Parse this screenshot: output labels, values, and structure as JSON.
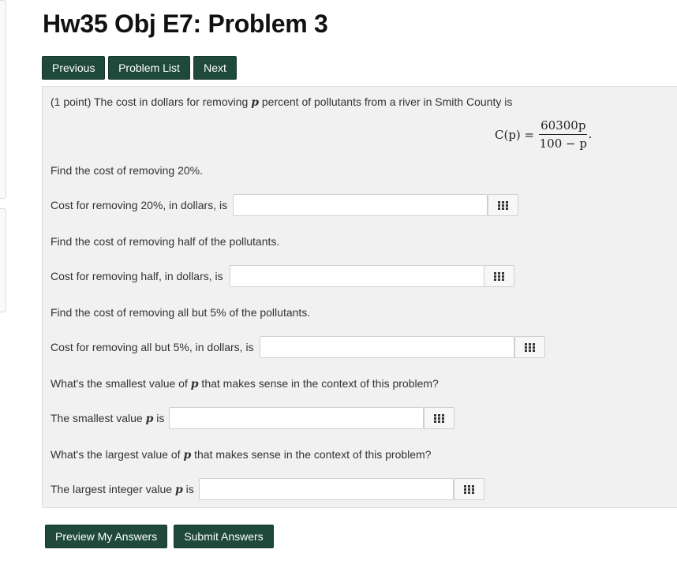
{
  "page": {
    "title": "Hw35 Obj E7: Problem 3"
  },
  "nav": {
    "previous_label": "Previous",
    "problem_list_label": "Problem List",
    "next_label": "Next"
  },
  "problem": {
    "intro_prefix": "(1 point) The cost in dollars for removing ",
    "intro_var": "p",
    "intro_suffix": " percent of pollutants from a river in Smith County is",
    "formula": {
      "lhs": "C(p) =",
      "numerator": "60300p",
      "denominator": "100 − p",
      "trailing": "."
    },
    "q1": {
      "prompt": "Find the cost of removing 20%.",
      "label": "Cost for removing 20%, in dollars, is",
      "value": ""
    },
    "q2": {
      "prompt": "Find the cost of removing half of the pollutants.",
      "label": "Cost for removing half, in dollars, is",
      "value": ""
    },
    "q3": {
      "prompt": "Find the cost of removing all but 5% of the pollutants.",
      "label": "Cost for removing all but 5%, in dollars, is",
      "value": ""
    },
    "q4": {
      "prompt_prefix": "What's the smallest value of ",
      "prompt_var": "p",
      "prompt_suffix": " that makes sense in the context of this problem?",
      "label_prefix": "The smallest value ",
      "label_var": "p",
      "label_suffix": " is",
      "value": ""
    },
    "q5": {
      "prompt_prefix": "What's the largest value of ",
      "prompt_var": "p",
      "prompt_suffix": " that makes sense in the context of this problem?",
      "label_prefix": "The largest integer value ",
      "label_var": "p",
      "label_suffix": " is",
      "value": ""
    },
    "equation_editor_icon": "grid-icon"
  },
  "actions": {
    "preview_label": "Preview My Answers",
    "submit_label": "Submit Answers"
  },
  "colors": {
    "button_bg": "#1f4a3b",
    "panel_bg": "#f1f1f1"
  }
}
